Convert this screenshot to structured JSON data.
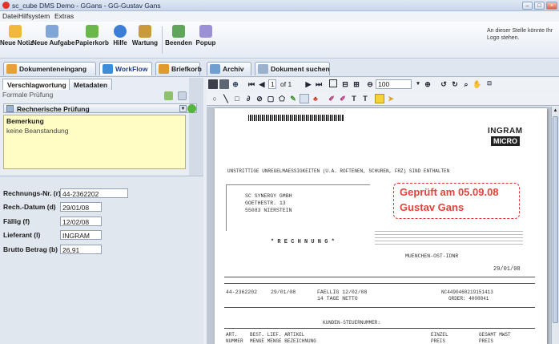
{
  "window": {
    "title": "sc_cube DMS Demo - GGans - GG-Gustav Gans",
    "controls": [
      "–",
      "□",
      "×"
    ]
  },
  "menubar": [
    "Datei",
    "Hilfsystem",
    "Extras"
  ],
  "toolbar": {
    "buttons": [
      {
        "label": "Neue Notiz",
        "color": "#f2b83a"
      },
      {
        "label": "Neue Aufgabe",
        "color": "#7fa6d6"
      },
      {
        "label": "Papierkorb",
        "color": "#6bb84a"
      },
      {
        "label": "Hilfe",
        "color": "#3b7ed6"
      },
      {
        "label": "Wartung",
        "color": "#c99a3a"
      },
      {
        "label": "Beenden",
        "color": "#5fa65a"
      },
      {
        "label": "Popup",
        "color": "#9b8fd6"
      }
    ],
    "logo_note": "An dieser Stelle könnte Ihr Logo stehen."
  },
  "tabs": [
    {
      "label": "Dokumenteneingang",
      "color": "#e6a23a"
    },
    {
      "label": "WorkFlow",
      "color": "#3e8ed8",
      "active": true
    },
    {
      "label": "Briefkorb",
      "color": "#e09a2e"
    },
    {
      "label": "Archiv",
      "color": "#6f9fd0"
    },
    {
      "label": "Dokument suchen",
      "color": "#9bb1cc"
    }
  ],
  "left": {
    "subtabs": [
      "Verschlagwortung",
      "Metadaten"
    ],
    "formular": "Formale Prüfung",
    "pruefung": "Rechnerische Prüfung",
    "bemerkung_label": "Bemerkung",
    "bemerkung_text": "keine Beanstandung",
    "fields": [
      {
        "label": "Rechnungs-Nr. (r)",
        "value": "44-2362202"
      },
      {
        "label": "Rech.-Datum (d)",
        "value": "29/01/08"
      },
      {
        "label": "Fällig (f)",
        "value": "12/02/08"
      },
      {
        "label": "Lieferant (l)",
        "value": "INGRAM"
      },
      {
        "label": "Brutto Betrag (b)",
        "value": "26,91"
      }
    ]
  },
  "viewer": {
    "page_current": "1",
    "page_total": "of 1",
    "zoom": "100"
  },
  "document": {
    "header": "UNSTRITTIGE UNREGELMAESSIGKEITEN (U.A. ROFTENEN, SCHUREN, FRZ) SIND ENTHALTEN",
    "address": [
      "SC SYNERGY GMBH",
      "GOETHESTR. 13",
      "55083 NIERSTEIN"
    ],
    "doc_title": "* R E C H N U N G *",
    "branch": "MUENCHEN-OST-IDNR",
    "date": "29/01/08",
    "row": {
      "nr": "44-2362202",
      "datum": "29/01/08",
      "faellig": "FAELLIG   12/02/08",
      "tage": "14 TAGE NETTO",
      "ref": "NC4490460219151413",
      "order": "ORDER: 4008841"
    },
    "section": "KUNDEN-STEUERNUMMER:",
    "cols": [
      "ART.",
      "BEST. LIEF. ARTIKEL",
      "EINZEL",
      "GESAMT MWST"
    ],
    "cols2": [
      "NUMMER",
      "MENGE MENGE BEZEICHNUNG",
      "PREIS",
      "PREIS"
    ],
    "logo": [
      "INGRAM",
      "MICRO"
    ],
    "stamp": [
      "Geprüft am 05.09.08",
      "Gustav Gans"
    ]
  }
}
